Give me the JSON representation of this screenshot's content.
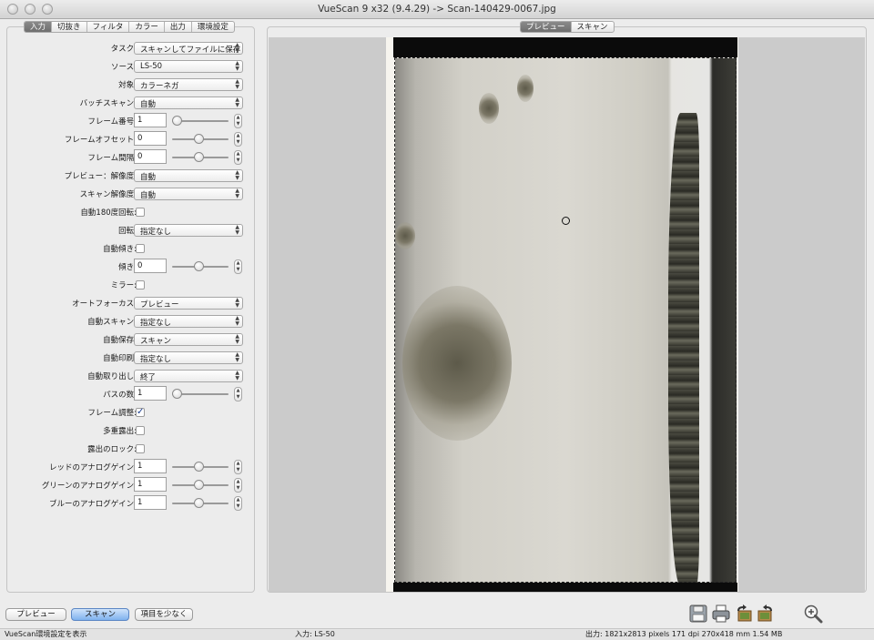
{
  "window": {
    "title": "VueScan 9 x32 (9.4.29) -> Scan-140429-0067.jpg"
  },
  "left_tabs": [
    "入力",
    "切抜き",
    "フィルタ",
    "カラー",
    "出力",
    "環境設定"
  ],
  "preview_tabs": [
    "プレビュー",
    "スキャン"
  ],
  "form": {
    "task": {
      "label": "タスク:",
      "value": "スキャンしてファイルに保存"
    },
    "source": {
      "label": "ソース:",
      "value": "LS-50"
    },
    "media": {
      "label": "対象:",
      "value": "カラーネガ"
    },
    "batch_scan": {
      "label": "バッチスキャン:",
      "value": "自動"
    },
    "frame_number": {
      "label": "フレーム番号:",
      "value": "1"
    },
    "frame_offset": {
      "label": "フレームオフセット:",
      "value": "0"
    },
    "frame_spacing": {
      "label": "フレーム間隔:",
      "value": "0"
    },
    "preview_resolution": {
      "label": "プレビュー：解像度:",
      "value": "自動"
    },
    "scan_resolution": {
      "label": "スキャン解像度:",
      "value": "自動"
    },
    "auto_rotate_180": {
      "label": "自動180度回転:",
      "checked": false
    },
    "rotation": {
      "label": "回転:",
      "value": "指定なし"
    },
    "auto_skew": {
      "label": "自動傾き:",
      "checked": false
    },
    "skew": {
      "label": "傾き:",
      "value": "0"
    },
    "mirror": {
      "label": "ミラー:",
      "checked": false
    },
    "autofocus": {
      "label": "オートフォーカス:",
      "value": "プレビュー"
    },
    "auto_scan": {
      "label": "自動スキャン:",
      "value": "指定なし"
    },
    "auto_save": {
      "label": "自動保存:",
      "value": "スキャン"
    },
    "auto_print": {
      "label": "自動印刷:",
      "value": "指定なし"
    },
    "auto_eject": {
      "label": "自動取り出し:",
      "value": "終了"
    },
    "passes": {
      "label": "パスの数:",
      "value": "1"
    },
    "frame_adjust": {
      "label": "フレーム調整:",
      "checked": true
    },
    "multi_exposure": {
      "label": "多重露出:",
      "checked": false
    },
    "lock_exposure": {
      "label": "露出のロック:",
      "checked": false
    },
    "red_gain": {
      "label": "レッドのアナログゲイン:",
      "value": "1"
    },
    "green_gain": {
      "label": "グリーンのアナログゲイン:",
      "value": "1"
    },
    "blue_gain": {
      "label": "ブルーのアナログゲイン:",
      "value": "1"
    }
  },
  "buttons": {
    "preview": "プレビュー",
    "scan": "スキャン",
    "fewer_options": "項目を少なく"
  },
  "toolbar_icons": [
    "save-icon",
    "print-icon",
    "rotate-left-icon",
    "rotate-right-icon",
    "zoom-in-icon"
  ],
  "status": {
    "left": "VueScan環境設定を表示",
    "center": "入力: LS-50",
    "right": "出力: 1821x2813 pixels 171 dpi 270x418 mm 1.54 MB"
  }
}
